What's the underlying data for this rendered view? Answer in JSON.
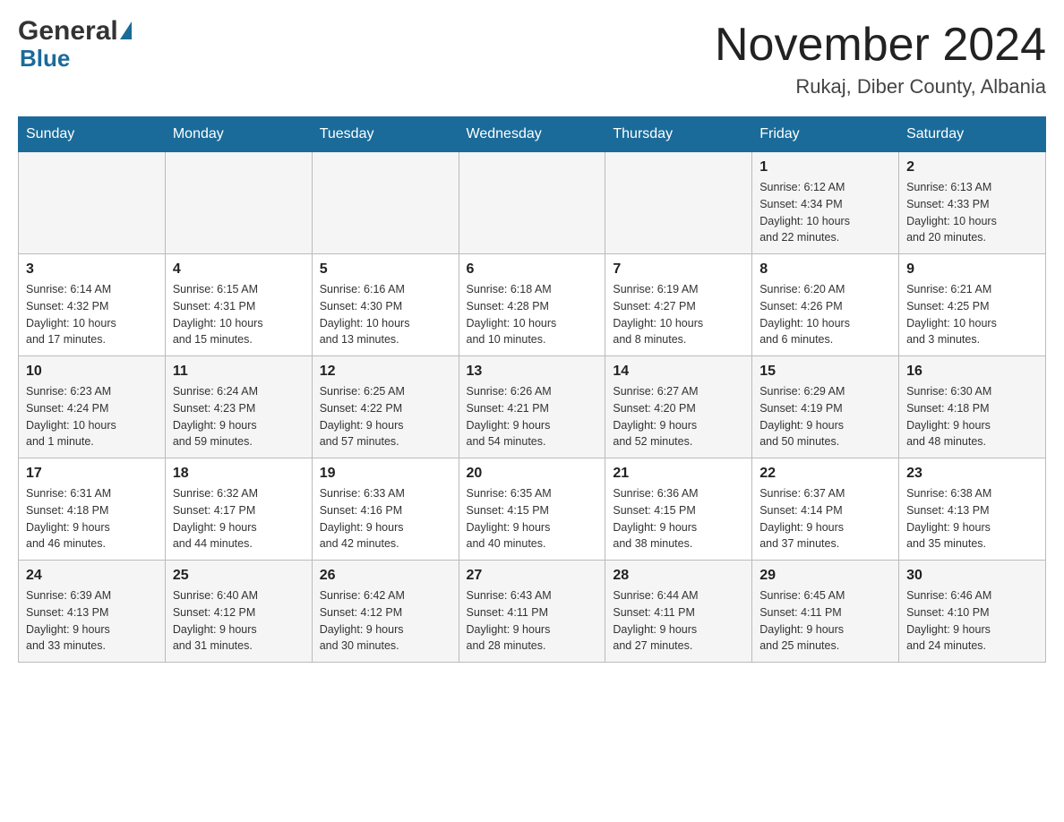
{
  "header": {
    "logo_general": "General",
    "logo_blue": "Blue",
    "month_title": "November 2024",
    "location": "Rukaj, Diber County, Albania"
  },
  "days_of_week": [
    "Sunday",
    "Monday",
    "Tuesday",
    "Wednesday",
    "Thursday",
    "Friday",
    "Saturday"
  ],
  "weeks": [
    {
      "days": [
        {
          "number": "",
          "info": ""
        },
        {
          "number": "",
          "info": ""
        },
        {
          "number": "",
          "info": ""
        },
        {
          "number": "",
          "info": ""
        },
        {
          "number": "",
          "info": ""
        },
        {
          "number": "1",
          "info": "Sunrise: 6:12 AM\nSunset: 4:34 PM\nDaylight: 10 hours\nand 22 minutes."
        },
        {
          "number": "2",
          "info": "Sunrise: 6:13 AM\nSunset: 4:33 PM\nDaylight: 10 hours\nand 20 minutes."
        }
      ]
    },
    {
      "days": [
        {
          "number": "3",
          "info": "Sunrise: 6:14 AM\nSunset: 4:32 PM\nDaylight: 10 hours\nand 17 minutes."
        },
        {
          "number": "4",
          "info": "Sunrise: 6:15 AM\nSunset: 4:31 PM\nDaylight: 10 hours\nand 15 minutes."
        },
        {
          "number": "5",
          "info": "Sunrise: 6:16 AM\nSunset: 4:30 PM\nDaylight: 10 hours\nand 13 minutes."
        },
        {
          "number": "6",
          "info": "Sunrise: 6:18 AM\nSunset: 4:28 PM\nDaylight: 10 hours\nand 10 minutes."
        },
        {
          "number": "7",
          "info": "Sunrise: 6:19 AM\nSunset: 4:27 PM\nDaylight: 10 hours\nand 8 minutes."
        },
        {
          "number": "8",
          "info": "Sunrise: 6:20 AM\nSunset: 4:26 PM\nDaylight: 10 hours\nand 6 minutes."
        },
        {
          "number": "9",
          "info": "Sunrise: 6:21 AM\nSunset: 4:25 PM\nDaylight: 10 hours\nand 3 minutes."
        }
      ]
    },
    {
      "days": [
        {
          "number": "10",
          "info": "Sunrise: 6:23 AM\nSunset: 4:24 PM\nDaylight: 10 hours\nand 1 minute."
        },
        {
          "number": "11",
          "info": "Sunrise: 6:24 AM\nSunset: 4:23 PM\nDaylight: 9 hours\nand 59 minutes."
        },
        {
          "number": "12",
          "info": "Sunrise: 6:25 AM\nSunset: 4:22 PM\nDaylight: 9 hours\nand 57 minutes."
        },
        {
          "number": "13",
          "info": "Sunrise: 6:26 AM\nSunset: 4:21 PM\nDaylight: 9 hours\nand 54 minutes."
        },
        {
          "number": "14",
          "info": "Sunrise: 6:27 AM\nSunset: 4:20 PM\nDaylight: 9 hours\nand 52 minutes."
        },
        {
          "number": "15",
          "info": "Sunrise: 6:29 AM\nSunset: 4:19 PM\nDaylight: 9 hours\nand 50 minutes."
        },
        {
          "number": "16",
          "info": "Sunrise: 6:30 AM\nSunset: 4:18 PM\nDaylight: 9 hours\nand 48 minutes."
        }
      ]
    },
    {
      "days": [
        {
          "number": "17",
          "info": "Sunrise: 6:31 AM\nSunset: 4:18 PM\nDaylight: 9 hours\nand 46 minutes."
        },
        {
          "number": "18",
          "info": "Sunrise: 6:32 AM\nSunset: 4:17 PM\nDaylight: 9 hours\nand 44 minutes."
        },
        {
          "number": "19",
          "info": "Sunrise: 6:33 AM\nSunset: 4:16 PM\nDaylight: 9 hours\nand 42 minutes."
        },
        {
          "number": "20",
          "info": "Sunrise: 6:35 AM\nSunset: 4:15 PM\nDaylight: 9 hours\nand 40 minutes."
        },
        {
          "number": "21",
          "info": "Sunrise: 6:36 AM\nSunset: 4:15 PM\nDaylight: 9 hours\nand 38 minutes."
        },
        {
          "number": "22",
          "info": "Sunrise: 6:37 AM\nSunset: 4:14 PM\nDaylight: 9 hours\nand 37 minutes."
        },
        {
          "number": "23",
          "info": "Sunrise: 6:38 AM\nSunset: 4:13 PM\nDaylight: 9 hours\nand 35 minutes."
        }
      ]
    },
    {
      "days": [
        {
          "number": "24",
          "info": "Sunrise: 6:39 AM\nSunset: 4:13 PM\nDaylight: 9 hours\nand 33 minutes."
        },
        {
          "number": "25",
          "info": "Sunrise: 6:40 AM\nSunset: 4:12 PM\nDaylight: 9 hours\nand 31 minutes."
        },
        {
          "number": "26",
          "info": "Sunrise: 6:42 AM\nSunset: 4:12 PM\nDaylight: 9 hours\nand 30 minutes."
        },
        {
          "number": "27",
          "info": "Sunrise: 6:43 AM\nSunset: 4:11 PM\nDaylight: 9 hours\nand 28 minutes."
        },
        {
          "number": "28",
          "info": "Sunrise: 6:44 AM\nSunset: 4:11 PM\nDaylight: 9 hours\nand 27 minutes."
        },
        {
          "number": "29",
          "info": "Sunrise: 6:45 AM\nSunset: 4:11 PM\nDaylight: 9 hours\nand 25 minutes."
        },
        {
          "number": "30",
          "info": "Sunrise: 6:46 AM\nSunset: 4:10 PM\nDaylight: 9 hours\nand 24 minutes."
        }
      ]
    }
  ]
}
